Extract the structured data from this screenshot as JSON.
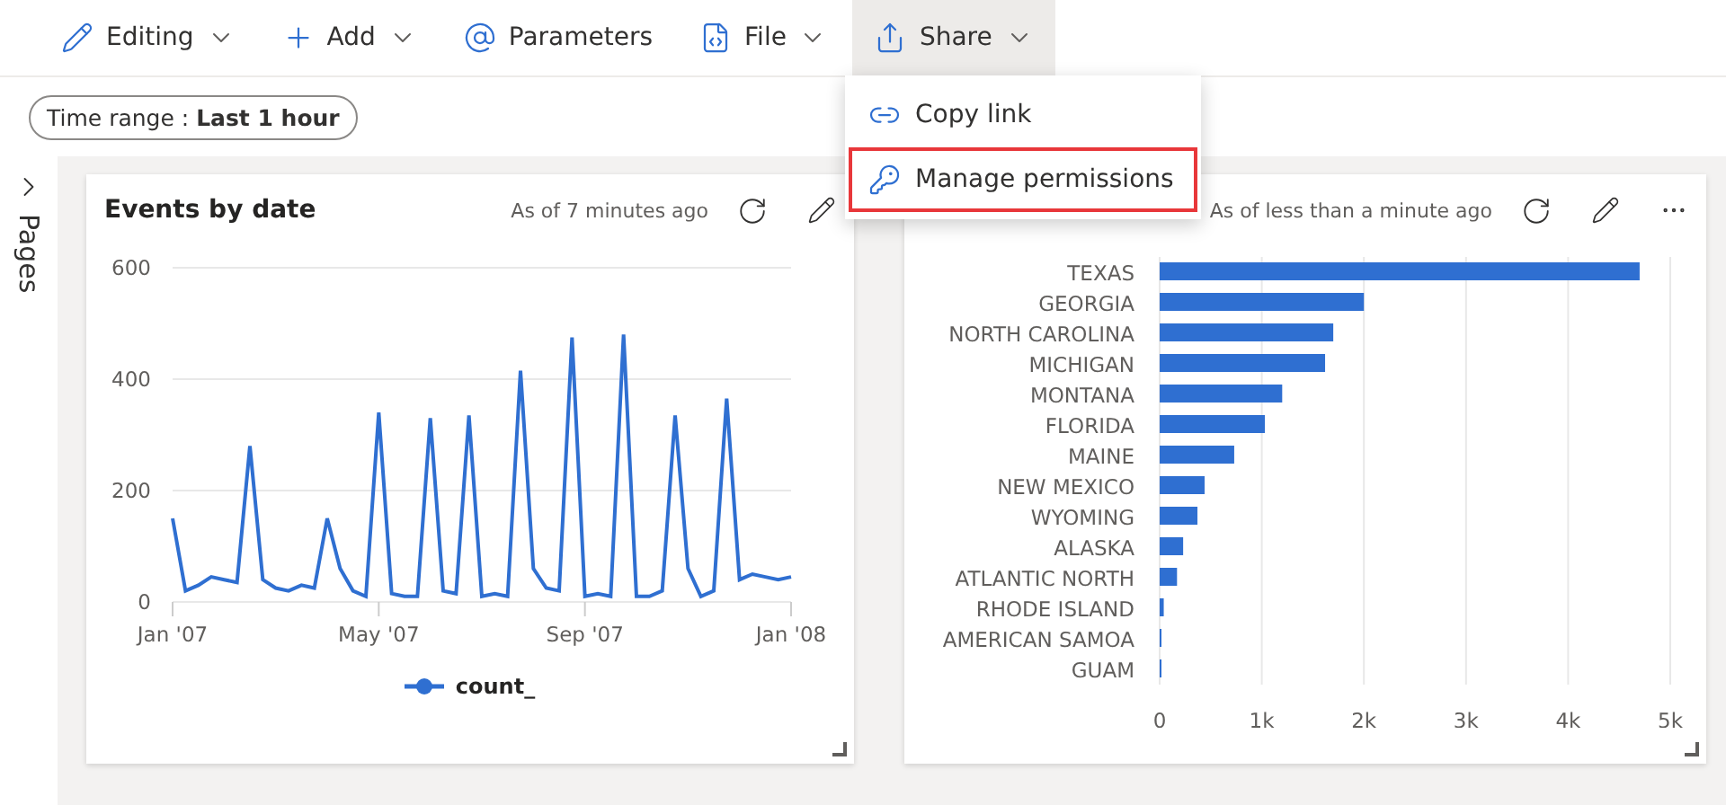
{
  "toolbar": [
    {
      "label": "Editing",
      "selected": false
    },
    {
      "label": "Add",
      "selected": false
    },
    {
      "label": "Parameters",
      "selected": false
    },
    {
      "label": "File",
      "selected": false
    },
    {
      "label": "Share",
      "selected": true
    }
  ],
  "share_menu": [
    {
      "label": "Copy link",
      "highlighted": false
    },
    {
      "label": "Manage permissions",
      "highlighted": true
    }
  ],
  "filter": {
    "text": "Time range : **Last 1 hour**"
  },
  "pages_pane": {
    "label": "Pages"
  },
  "tiles": [
    {
      "title": "Events by date",
      "updated": "As of 7 minutes ago",
      "has_more_menu": false,
      "chart_data": {
        "type": "line",
        "grid": true,
        "categories": [
          "Jan '07",
          null,
          null,
          null,
          null,
          null,
          null,
          null,
          null,
          null,
          null,
          null,
          null,
          null,
          null,
          null,
          "May '07",
          null,
          null,
          null,
          null,
          null,
          null,
          null,
          null,
          null,
          null,
          null,
          null,
          null,
          null,
          null,
          "Sep '07",
          null,
          null,
          null,
          null,
          null,
          null,
          null,
          null,
          null,
          null,
          null,
          null,
          null,
          null,
          null,
          "Jan '08"
        ],
        "series": [
          {
            "name": "count_",
            "color": "#2f6fd1",
            "values": [
              150,
              20,
              30,
              45,
              40,
              35,
              280,
              40,
              25,
              20,
              30,
              25,
              150,
              60,
              20,
              10,
              340,
              15,
              10,
              10,
              330,
              20,
              15,
              335,
              10,
              15,
              10,
              415,
              60,
              25,
              20,
              475,
              10,
              15,
              10,
              480,
              10,
              10,
              20,
              335,
              60,
              10,
              20,
              365,
              40,
              50,
              45,
              40,
              45
            ]
          }
        ],
        "ylim": [
          0,
          600
        ],
        "yticks": [
          0,
          200,
          400,
          600
        ]
      }
    },
    {
      "updated": "As of less than a minute ago",
      "has_more_menu": true,
      "chart_data": {
        "type": "bar",
        "orientation": "horizontal",
        "grid": true,
        "categories": [
          "TEXAS",
          "GEORGIA",
          "NORTH CAROLINA",
          "MICHIGAN",
          "MONTANA",
          "FLORIDA",
          "MAINE",
          "NEW MEXICO",
          "WYOMING",
          "ALASKA",
          "ATLANTIC NORTH",
          "RHODE ISLAND",
          "AMERICAN SAMOA",
          "GUAM"
        ],
        "series": [
          {
            "color": "#2f6fd1",
            "values": [
              4700,
              2000,
              1700,
              1620,
              1200,
              1030,
              730,
              440,
              370,
              230,
              170,
              40,
              10,
              0
            ]
          }
        ],
        "xlim": [
          0,
          5000
        ],
        "xticks": [
          {
            "value": 0,
            "label": "0"
          },
          {
            "value": 1000,
            "label": "1k"
          },
          {
            "value": 2000,
            "label": "2k"
          },
          {
            "value": 3000,
            "label": "3k"
          },
          {
            "value": 4000,
            "label": "4k"
          },
          {
            "value": 5000,
            "label": "5k"
          }
        ]
      }
    }
  ]
}
